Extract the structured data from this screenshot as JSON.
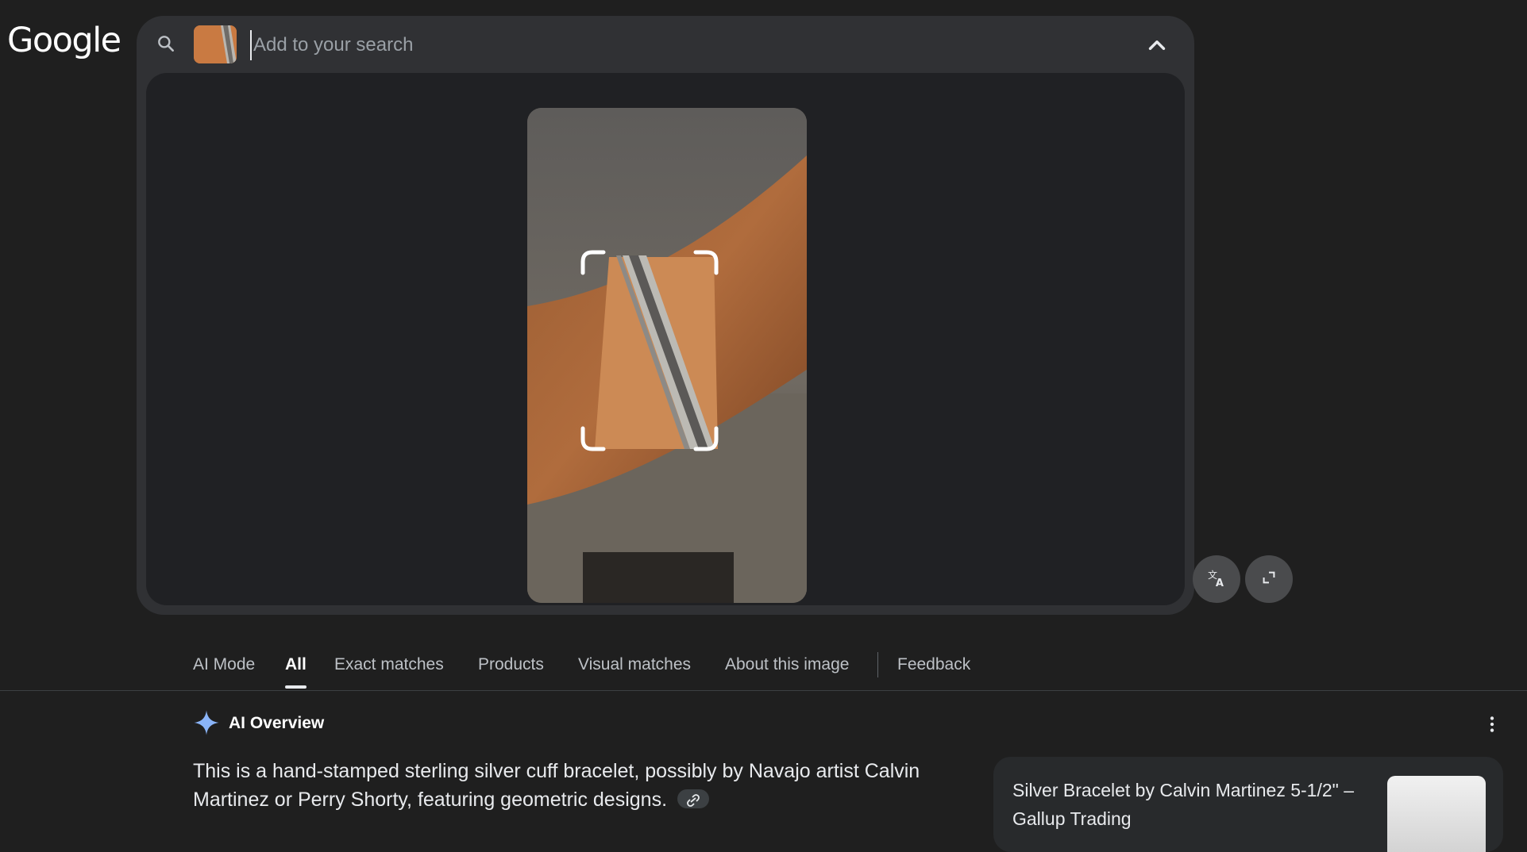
{
  "header": {
    "logo": "Google"
  },
  "search": {
    "placeholder": "Add to your search"
  },
  "tabs": [
    {
      "label": "AI Mode"
    },
    {
      "label": "All"
    },
    {
      "label": "Exact matches"
    },
    {
      "label": "Products"
    },
    {
      "label": "Visual matches"
    },
    {
      "label": "About this image"
    },
    {
      "label": "Feedback"
    }
  ],
  "active_tab": "All",
  "ai_overview": {
    "title": "AI Overview",
    "text": "This is a hand-stamped sterling silver cuff bracelet, possibly by Navajo artist Calvin Martinez or Perry Shorty, featuring geometric designs."
  },
  "result_card": {
    "title": "Silver Bracelet by Calvin Martinez 5-1/2\" – Gallup Trading"
  },
  "icons": {
    "search": "search-icon",
    "collapse": "chevron-up-icon",
    "translate": "translate-icon",
    "expand": "expand-icon",
    "ai": "sparkle-icon",
    "more": "more-vertical-icon",
    "link": "link-icon"
  },
  "colors": {
    "background": "#1f1f1f",
    "panel": "#303134",
    "ai_star": "#8ab4f8"
  }
}
